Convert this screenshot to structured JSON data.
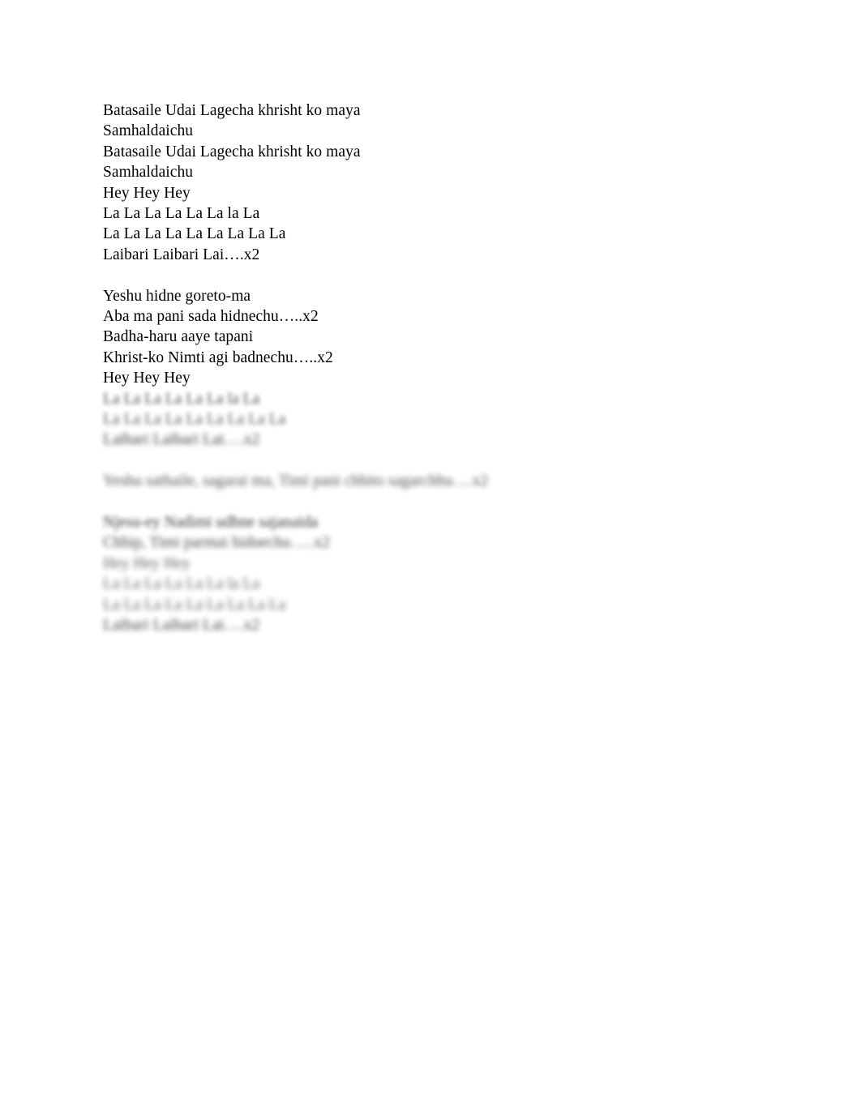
{
  "document": {
    "background_color": "#ffffff",
    "text_color": "#000000",
    "lines": [
      {
        "text": "Batasaile Udai Lagecha khrisht ko maya",
        "blur": 0
      },
      {
        "text": "Samhaldaichu",
        "blur": 0
      },
      {
        "text": "Batasaile Udai Lagecha khrisht ko maya",
        "blur": 0
      },
      {
        "text": "Samhaldaichu",
        "blur": 0
      },
      {
        "text": "Hey Hey Hey",
        "blur": 0
      },
      {
        "text": "La La La La La La la La",
        "blur": 0
      },
      {
        "text": "La La La La La La La La La",
        "blur": 0
      },
      {
        "text": "Laibari Laibari Lai….x2",
        "blur": 0
      },
      {
        "text": "",
        "blur": 0
      },
      {
        "text": "Yeshu hidne goreto-ma",
        "blur": 0
      },
      {
        "text": "Aba ma pani sada hidnechu…..x2",
        "blur": 0
      },
      {
        "text": "Badha-haru aaye tapani",
        "blur": 0
      },
      {
        "text": "Khrist-ko Nimti agi badnechu…..x2",
        "blur": 0
      },
      {
        "text": "Hey Hey Hey",
        "blur": 0
      },
      {
        "text": "La La La La La La la La",
        "blur": 1
      },
      {
        "text": "La La La La La La La La La",
        "blur": 2
      },
      {
        "text": "Laibari Laibari Lai….x2",
        "blur": 3
      },
      {
        "text": "",
        "blur": 0
      },
      {
        "text": "Yeshu sathaile, sagarai ma, Timi pani chhito sagarchhu….x2",
        "blur": 4
      },
      {
        "text": "",
        "blur": 0
      },
      {
        "text": "Njesu-ey Nadimi udhne sajanaida",
        "blur": 5
      },
      {
        "text": "Chhip, Timi parmai hidnechu…..x2",
        "blur": 6
      },
      {
        "text": "Hey Hey Hey",
        "blur": 7
      },
      {
        "text": "La La La La La La la La",
        "blur": 8
      },
      {
        "text": "La La La La La La La La La",
        "blur": 8
      },
      {
        "text": "Laibari Laibari Lai….x2",
        "blur": 9
      }
    ]
  }
}
